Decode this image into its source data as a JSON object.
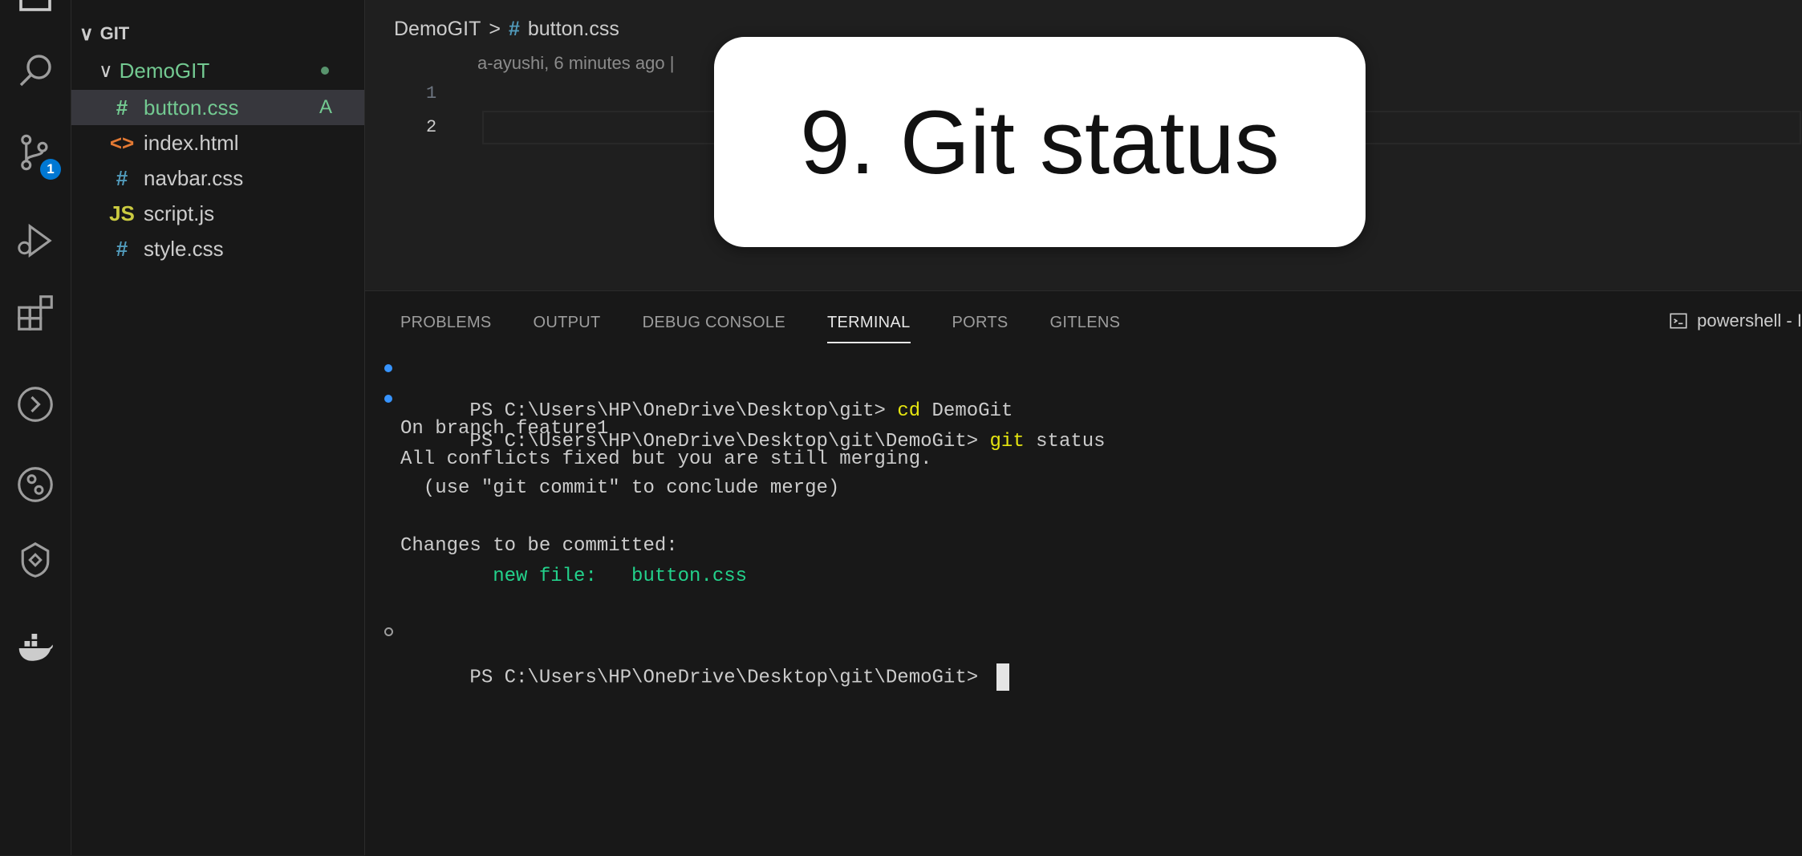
{
  "sidebar": {
    "root_label": "GIT",
    "folder_label": "DemoGIT",
    "files": [
      {
        "icon": "#",
        "name": "button.css",
        "status": "A",
        "color": "#73c991",
        "icon_color": "#73c991"
      },
      {
        "icon": "<>",
        "name": "index.html",
        "status": "",
        "color": "#cccccc",
        "icon_color": "#e37933"
      },
      {
        "icon": "#",
        "name": "navbar.css",
        "status": "",
        "color": "#cccccc",
        "icon_color": "#519aba"
      },
      {
        "icon": "JS",
        "name": "script.js",
        "status": "",
        "color": "#cccccc",
        "icon_color": "#cbcb41"
      },
      {
        "icon": "#",
        "name": "style.css",
        "status": "",
        "color": "#cccccc",
        "icon_color": "#519aba"
      }
    ]
  },
  "activity_bar": {
    "source_control_badge": "1",
    "icons": [
      "explorer-icon",
      "search-icon",
      "source-control-icon",
      "run-debug-icon",
      "extensions-icon",
      "remote-icon",
      "gitlens-icon",
      "gitlens-inspect-icon",
      "docker-icon"
    ]
  },
  "editor": {
    "breadcrumb_folder": "DemoGIT",
    "breadcrumb_separator": ">",
    "breadcrumb_file_icon": "#",
    "breadcrumb_file": "button.css",
    "blame": "a-ayushi, 6 minutes ago | ",
    "line_numbers": [
      "1",
      "2"
    ]
  },
  "overlay": {
    "title": "9. Git status"
  },
  "panel": {
    "tabs": [
      "PROBLEMS",
      "OUTPUT",
      "DEBUG CONSOLE",
      "TERMINAL",
      "PORTS",
      "GITLENS"
    ],
    "active_tab": "TERMINAL",
    "shell_label": "powershell - I"
  },
  "terminal": {
    "line1_prompt": "PS C:\\Users\\HP\\OneDrive\\Desktop\\git> ",
    "line1_cmd": "cd",
    "line1_arg": " DemoGit",
    "line2_prompt": "PS C:\\Users\\HP\\OneDrive\\Desktop\\git\\DemoGit> ",
    "line2_cmd": "git",
    "line2_arg": " status",
    "line3": "On branch feature1",
    "line4": "All conflicts fixed but you are still merging.",
    "line5": "  (use \"git commit\" to conclude merge)",
    "line6": "Changes to be committed:",
    "line7": "        new file:   button.css",
    "line8_prompt": "PS C:\\Users\\HP\\OneDrive\\Desktop\\git\\DemoGit> "
  }
}
